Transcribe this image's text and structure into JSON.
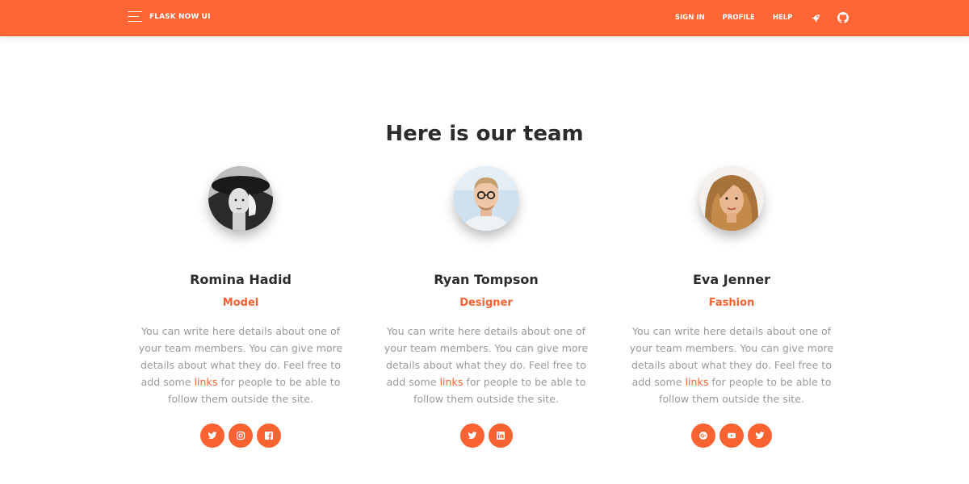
{
  "navbar": {
    "brand": "FLASK NOW UI",
    "links": [
      "SIGN IN",
      "PROFILE",
      "HELP"
    ],
    "icons": [
      "rocket-icon",
      "github-icon"
    ],
    "background_color": "#ff6535"
  },
  "section": {
    "title": "Here is our team"
  },
  "team": [
    {
      "name": "Romina Hadid",
      "role": "Model",
      "description": {
        "before": "You can write here details about one of your team members. You can give more details about what they do. Feel free to add some ",
        "link": "links",
        "after": " for people to be able to follow them outside the site."
      },
      "socials": [
        "twitter-icon",
        "instagram-icon",
        "facebook-icon"
      ]
    },
    {
      "name": "Ryan Tompson",
      "role": "Designer",
      "description": {
        "before": "You can write here details about one of your team members. You can give more details about what they do. Feel free to add some ",
        "link": "links",
        "after": " for people to be able to follow them outside the site."
      },
      "socials": [
        "twitter-icon",
        "linkedin-icon"
      ]
    },
    {
      "name": "Eva Jenner",
      "role": "Fashion",
      "description": {
        "before": "You can write here details about one of your team members. You can give more details about what they do. Feel free to add some ",
        "link": "links",
        "after": " for people to be able to follow them outside the site."
      },
      "socials": [
        "google-plus-icon",
        "youtube-icon",
        "twitter-icon"
      ]
    }
  ],
  "colors": {
    "accent": "#f96332",
    "text_dark": "#2c2c2c",
    "text_muted": "#9a9a9a"
  }
}
